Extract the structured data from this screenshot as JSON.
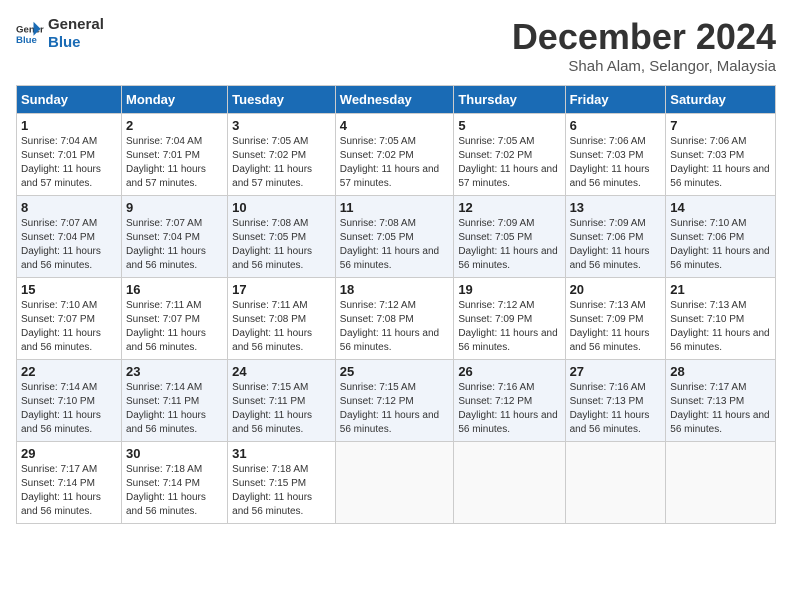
{
  "logo": {
    "line1": "General",
    "line2": "Blue"
  },
  "title": "December 2024",
  "subtitle": "Shah Alam, Selangor, Malaysia",
  "days_of_week": [
    "Sunday",
    "Monday",
    "Tuesday",
    "Wednesday",
    "Thursday",
    "Friday",
    "Saturday"
  ],
  "weeks": [
    [
      {
        "day": "1",
        "rise": "7:04 AM",
        "set": "7:01 PM",
        "daylight": "11 hours and 57 minutes."
      },
      {
        "day": "2",
        "rise": "7:04 AM",
        "set": "7:01 PM",
        "daylight": "11 hours and 57 minutes."
      },
      {
        "day": "3",
        "rise": "7:05 AM",
        "set": "7:02 PM",
        "daylight": "11 hours and 57 minutes."
      },
      {
        "day": "4",
        "rise": "7:05 AM",
        "set": "7:02 PM",
        "daylight": "11 hours and 57 minutes."
      },
      {
        "day": "5",
        "rise": "7:05 AM",
        "set": "7:02 PM",
        "daylight": "11 hours and 57 minutes."
      },
      {
        "day": "6",
        "rise": "7:06 AM",
        "set": "7:03 PM",
        "daylight": "11 hours and 56 minutes."
      },
      {
        "day": "7",
        "rise": "7:06 AM",
        "set": "7:03 PM",
        "daylight": "11 hours and 56 minutes."
      }
    ],
    [
      {
        "day": "8",
        "rise": "7:07 AM",
        "set": "7:04 PM",
        "daylight": "11 hours and 56 minutes."
      },
      {
        "day": "9",
        "rise": "7:07 AM",
        "set": "7:04 PM",
        "daylight": "11 hours and 56 minutes."
      },
      {
        "day": "10",
        "rise": "7:08 AM",
        "set": "7:05 PM",
        "daylight": "11 hours and 56 minutes."
      },
      {
        "day": "11",
        "rise": "7:08 AM",
        "set": "7:05 PM",
        "daylight": "11 hours and 56 minutes."
      },
      {
        "day": "12",
        "rise": "7:09 AM",
        "set": "7:05 PM",
        "daylight": "11 hours and 56 minutes."
      },
      {
        "day": "13",
        "rise": "7:09 AM",
        "set": "7:06 PM",
        "daylight": "11 hours and 56 minutes."
      },
      {
        "day": "14",
        "rise": "7:10 AM",
        "set": "7:06 PM",
        "daylight": "11 hours and 56 minutes."
      }
    ],
    [
      {
        "day": "15",
        "rise": "7:10 AM",
        "set": "7:07 PM",
        "daylight": "11 hours and 56 minutes."
      },
      {
        "day": "16",
        "rise": "7:11 AM",
        "set": "7:07 PM",
        "daylight": "11 hours and 56 minutes."
      },
      {
        "day": "17",
        "rise": "7:11 AM",
        "set": "7:08 PM",
        "daylight": "11 hours and 56 minutes."
      },
      {
        "day": "18",
        "rise": "7:12 AM",
        "set": "7:08 PM",
        "daylight": "11 hours and 56 minutes."
      },
      {
        "day": "19",
        "rise": "7:12 AM",
        "set": "7:09 PM",
        "daylight": "11 hours and 56 minutes."
      },
      {
        "day": "20",
        "rise": "7:13 AM",
        "set": "7:09 PM",
        "daylight": "11 hours and 56 minutes."
      },
      {
        "day": "21",
        "rise": "7:13 AM",
        "set": "7:10 PM",
        "daylight": "11 hours and 56 minutes."
      }
    ],
    [
      {
        "day": "22",
        "rise": "7:14 AM",
        "set": "7:10 PM",
        "daylight": "11 hours and 56 minutes."
      },
      {
        "day": "23",
        "rise": "7:14 AM",
        "set": "7:11 PM",
        "daylight": "11 hours and 56 minutes."
      },
      {
        "day": "24",
        "rise": "7:15 AM",
        "set": "7:11 PM",
        "daylight": "11 hours and 56 minutes."
      },
      {
        "day": "25",
        "rise": "7:15 AM",
        "set": "7:12 PM",
        "daylight": "11 hours and 56 minutes."
      },
      {
        "day": "26",
        "rise": "7:16 AM",
        "set": "7:12 PM",
        "daylight": "11 hours and 56 minutes."
      },
      {
        "day": "27",
        "rise": "7:16 AM",
        "set": "7:13 PM",
        "daylight": "11 hours and 56 minutes."
      },
      {
        "day": "28",
        "rise": "7:17 AM",
        "set": "7:13 PM",
        "daylight": "11 hours and 56 minutes."
      }
    ],
    [
      {
        "day": "29",
        "rise": "7:17 AM",
        "set": "7:14 PM",
        "daylight": "11 hours and 56 minutes."
      },
      {
        "day": "30",
        "rise": "7:18 AM",
        "set": "7:14 PM",
        "daylight": "11 hours and 56 minutes."
      },
      {
        "day": "31",
        "rise": "7:18 AM",
        "set": "7:15 PM",
        "daylight": "11 hours and 56 minutes."
      },
      null,
      null,
      null,
      null
    ]
  ],
  "labels": {
    "sunrise": "Sunrise:",
    "sunset": "Sunset:",
    "daylight": "Daylight:"
  }
}
